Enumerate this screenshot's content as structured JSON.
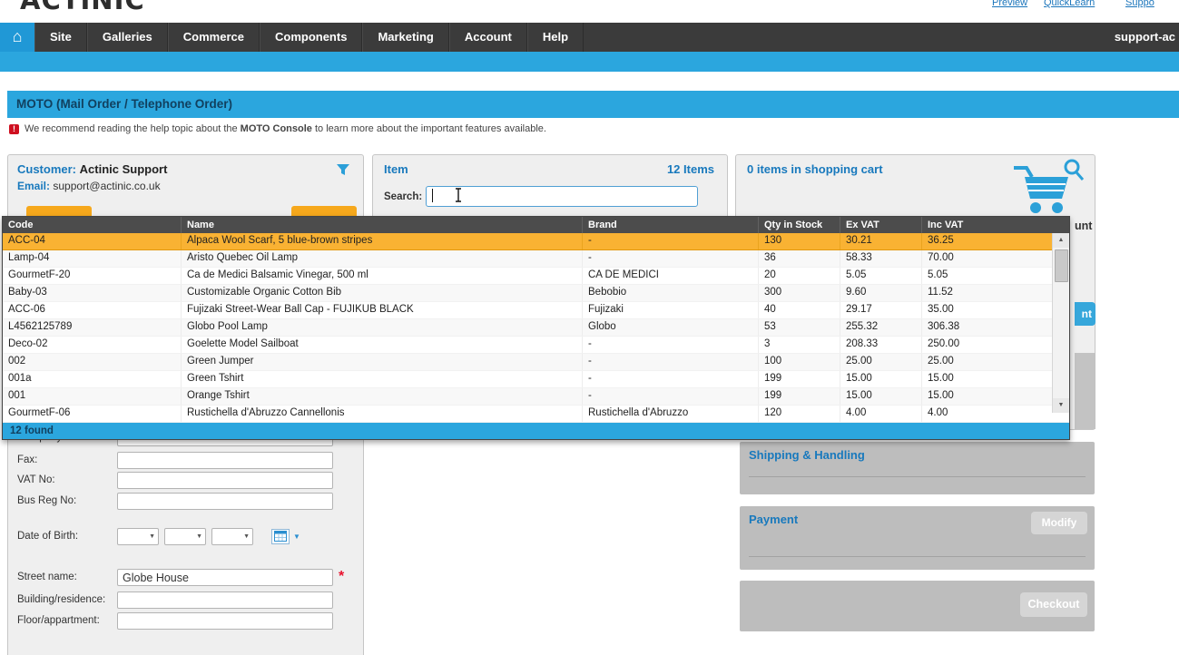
{
  "ui": {
    "home_glyph": "⌂",
    "warning_glyph": "!",
    "select_arrow": "▼",
    "scroll_up": "▲",
    "scroll_down": "▼",
    "required_mark": "*"
  },
  "header": {
    "logo_fragment": "ACTINIC",
    "links": [
      "Preview",
      "QuickLearn",
      "Suppo"
    ],
    "nav_items": [
      "Site",
      "Galleries",
      "Commerce",
      "Components",
      "Marketing",
      "Account",
      "Help"
    ],
    "nav_user": "support-ac"
  },
  "moto": {
    "title": "MOTO (Mail Order / Telephone Order)",
    "notice_prefix": "We recommend reading the help topic about the ",
    "notice_bold": "MOTO Console",
    "notice_suffix": " to learn more about the important features available."
  },
  "customer": {
    "label": "Customer:",
    "name": "Actinic Support",
    "email_label": "Email:",
    "email": "support@actinic.co.uk",
    "fields": [
      {
        "label": "Company:"
      },
      {
        "label": "Fax:"
      },
      {
        "label": "VAT No:"
      },
      {
        "label": "Bus Reg No:"
      }
    ],
    "dob_label": "Date of Birth:",
    "street_label": "Street name:",
    "street_value": "Globe House",
    "building_label": "Building/residence:",
    "floor_label": "Floor/appartment:"
  },
  "item_panel": {
    "title": "Item",
    "count_label": "12 Items",
    "search_label": "Search:",
    "search_value": ""
  },
  "cart": {
    "title": "0 items in shopping cart",
    "account_fragment": "unt",
    "button_fragment": "nt",
    "shipping_title": "Shipping & Handling",
    "payment_title": "Payment",
    "modify_label": "Modify",
    "checkout_label": "Checkout"
  },
  "results": {
    "columns": [
      "Code",
      "Name",
      "Brand",
      "Qty in Stock",
      "Ex VAT",
      "Inc VAT"
    ],
    "selected_index": 0,
    "footer": "12 found",
    "rows": [
      {
        "code": "ACC-04",
        "name": "Alpaca Wool Scarf, 5 blue-brown stripes",
        "brand": "-",
        "qty": "130",
        "ex_vat": "30.21",
        "inc_vat": "36.25"
      },
      {
        "code": "Lamp-04",
        "name": "Aristo Quebec Oil Lamp",
        "brand": "-",
        "qty": "36",
        "ex_vat": "58.33",
        "inc_vat": "70.00"
      },
      {
        "code": "GourmetF-20",
        "name": "Ca de Medici Balsamic Vinegar, 500 ml",
        "brand": "CA DE MEDICI",
        "qty": "20",
        "ex_vat": "5.05",
        "inc_vat": "5.05"
      },
      {
        "code": "Baby-03",
        "name": "Customizable Organic Cotton Bib",
        "brand": "Bebobio",
        "qty": "300",
        "ex_vat": "9.60",
        "inc_vat": "11.52"
      },
      {
        "code": "ACC-06",
        "name": "Fujizaki Street-Wear Ball Cap - FUJIKUB BLACK",
        "brand": "Fujizaki",
        "qty": "40",
        "ex_vat": "29.17",
        "inc_vat": "35.00"
      },
      {
        "code": "L4562125789",
        "name": "Globo Pool Lamp",
        "brand": "Globo",
        "qty": "53",
        "ex_vat": "255.32",
        "inc_vat": "306.38"
      },
      {
        "code": "Deco-02",
        "name": "Goelette Model Sailboat",
        "brand": "-",
        "qty": "3",
        "ex_vat": "208.33",
        "inc_vat": "250.00"
      },
      {
        "code": "002",
        "name": "Green Jumper",
        "brand": "-",
        "qty": "100",
        "ex_vat": "25.00",
        "inc_vat": "25.00"
      },
      {
        "code": "001a",
        "name": "Green Tshirt",
        "brand": "-",
        "qty": "199",
        "ex_vat": "15.00",
        "inc_vat": "15.00"
      },
      {
        "code": "001",
        "name": "Orange Tshirt",
        "brand": "-",
        "qty": "199",
        "ex_vat": "15.00",
        "inc_vat": "15.00"
      },
      {
        "code": "GourmetF-06",
        "name": "Rustichella d'Abruzzo Cannellonis",
        "brand": "Rustichella d'Abruzzo",
        "qty": "120",
        "ex_vat": "4.00",
        "inc_vat": "4.00"
      }
    ]
  },
  "colors": {
    "accent_blue": "#2ba6de",
    "heading_blue": "#1879bd",
    "selected_orange": "#f9b233",
    "nav_dark": "#3b3b3b"
  }
}
